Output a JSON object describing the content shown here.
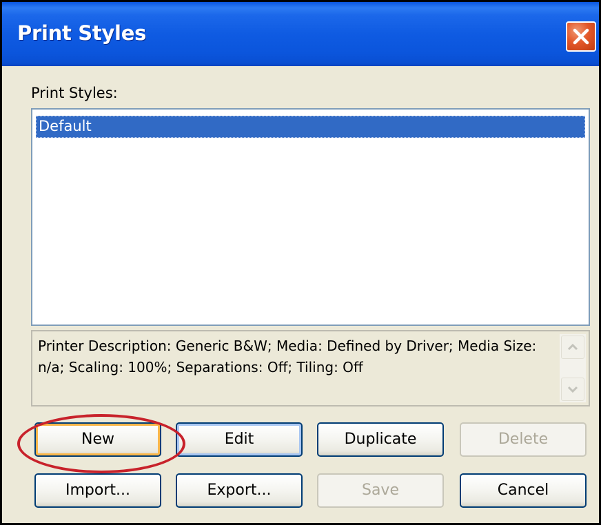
{
  "window": {
    "title": "Print Styles"
  },
  "list": {
    "label": "Print Styles:",
    "items": [
      "Default"
    ],
    "selected": "Default"
  },
  "description": {
    "text": "Printer Description: Generic B&W;   Media: Defined by Driver;   Media Size: n/a;   Scaling: 100%;   Separations: Off;   Tiling: Off"
  },
  "buttons": {
    "new": "New",
    "edit": "Edit",
    "duplicate": "Duplicate",
    "delete": "Delete",
    "import": "Import...",
    "export": "Export...",
    "save": "Save",
    "cancel": "Cancel"
  },
  "icons": {
    "close": "close-icon",
    "scroll_up": "scroll-up-arrow-icon",
    "scroll_down": "scroll-down-arrow-icon"
  },
  "colors": {
    "titlebar": "#0a56e0",
    "selection": "#316ac5",
    "close": "#e3582a",
    "highlight_annotation": "#c8222b"
  }
}
